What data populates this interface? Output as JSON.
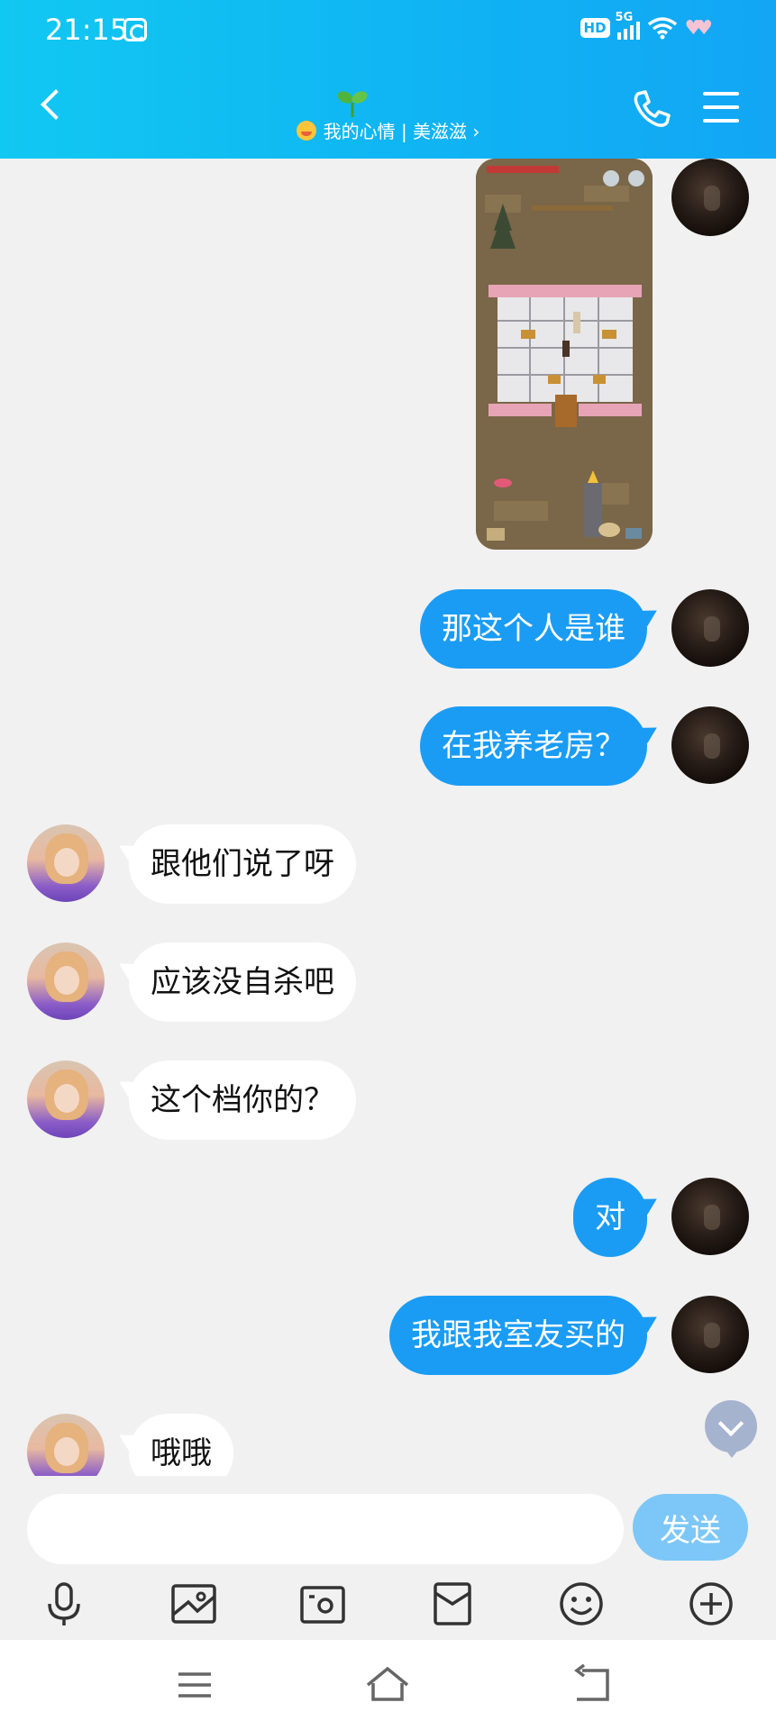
{
  "status_bar": {
    "time": "21:15",
    "hd": "HD",
    "network": "5G"
  },
  "header": {
    "title": "我的心情 | 美滋滋 ›"
  },
  "messages": [
    {
      "side": "out",
      "type": "image",
      "alt": ""
    },
    {
      "side": "out",
      "type": "text",
      "text": "那这个人是谁"
    },
    {
      "side": "out",
      "type": "text",
      "text": "在我养老房？"
    },
    {
      "side": "in",
      "type": "text",
      "text": "跟他们说了呀"
    },
    {
      "side": "in",
      "type": "text",
      "text": "应该没自杀吧"
    },
    {
      "side": "in",
      "type": "text",
      "text": "这个档你的？"
    },
    {
      "side": "out",
      "type": "text",
      "text": "对"
    },
    {
      "side": "out",
      "type": "text",
      "text": "我跟我室友买的"
    },
    {
      "side": "in",
      "type": "text",
      "text": "哦哦"
    }
  ],
  "input": {
    "placeholder": "",
    "value": "",
    "send_label": "发送"
  },
  "toolbar": {
    "icons": [
      "microphone-icon",
      "image-icon",
      "camera-icon",
      "red-packet-icon",
      "emoji-icon",
      "plus-icon"
    ]
  },
  "nav": {
    "icons": [
      "recent-apps-icon",
      "home-icon",
      "back-icon"
    ]
  },
  "colors": {
    "header": "#11c8f2",
    "outgoing_bubble": "#1a9cf5",
    "incoming_bubble": "#ffffff",
    "send_button": "#7cc7f7",
    "background": "#f1f1f1"
  }
}
